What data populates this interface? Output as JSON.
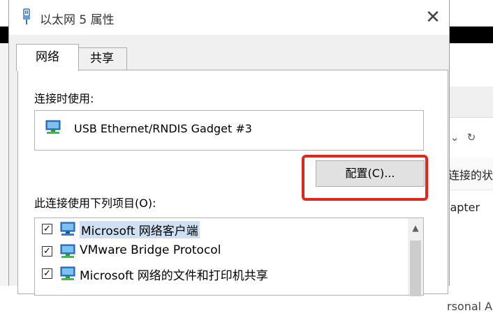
{
  "background": {
    "right_text_1": "连接的状",
    "right_text_2": "lapter",
    "right_text_3": "rsonal A",
    "nav_dropdown_glyph": "⌄",
    "refresh_glyph": "↻"
  },
  "dialog": {
    "title": "以太网 5 属性",
    "close_glyph": "✕",
    "tabs": [
      {
        "label": "网络",
        "active": true
      },
      {
        "label": "共享",
        "active": false
      }
    ],
    "connect_using_label": "连接时使用:",
    "device_name": "USB Ethernet/RNDIS Gadget #3",
    "config_button_label": "配置(C)...",
    "items_label": "此连接使用下列项目(O):",
    "items": [
      {
        "label": "Microsoft 网络客户端",
        "checked": true,
        "icon": "network-client-icon"
      },
      {
        "label": "VMware Bridge Protocol",
        "checked": true,
        "icon": "network-protocol-icon"
      },
      {
        "label": "Microsoft 网络的文件和打印机共享",
        "checked": true,
        "icon": "file-printer-sharing-icon"
      }
    ],
    "check_glyph": "✓",
    "scroll_up_glyph": "▲"
  },
  "colors": {
    "highlight": "#e3261b",
    "selection": "#cfe0f5"
  }
}
